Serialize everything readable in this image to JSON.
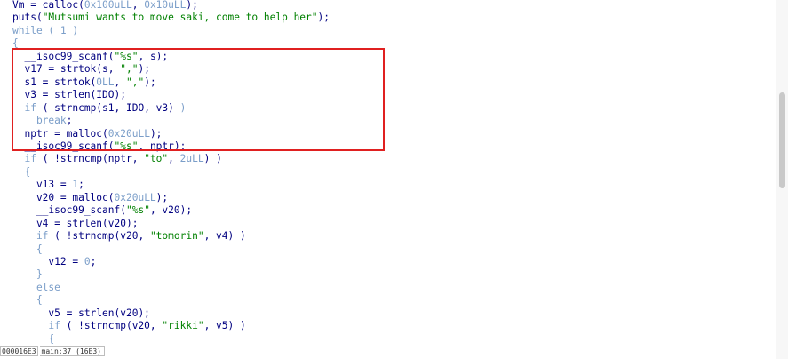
{
  "code_lines": [
    {
      "tokens": [
        {
          "t": "Vm = calloc(",
          "c": "plain"
        },
        {
          "t": "0x100uLL",
          "c": "num"
        },
        {
          "t": ", ",
          "c": "plain"
        },
        {
          "t": "0x10uLL",
          "c": "num"
        },
        {
          "t": ");",
          "c": "plain"
        }
      ]
    },
    {
      "tokens": [
        {
          "t": "puts(",
          "c": "plain"
        },
        {
          "t": "\"Mutsumi wants to move saki, come to help her\"",
          "c": "str"
        },
        {
          "t": ");",
          "c": "plain"
        }
      ]
    },
    {
      "tokens": [
        {
          "t": "while",
          "c": "kw"
        },
        {
          "t": " ( ",
          "c": "kw"
        },
        {
          "t": "1",
          "c": "num"
        },
        {
          "t": " )",
          "c": "kw"
        }
      ]
    },
    {
      "tokens": [
        {
          "t": "{",
          "c": "brace"
        }
      ]
    },
    {
      "tokens": [
        {
          "t": "  __isoc99_scanf(",
          "c": "plain"
        },
        {
          "t": "\"%s\"",
          "c": "str"
        },
        {
          "t": ", s);",
          "c": "plain"
        }
      ]
    },
    {
      "tokens": [
        {
          "t": "  v17 = strtok(s, ",
          "c": "plain"
        },
        {
          "t": "\",\"",
          "c": "str"
        },
        {
          "t": ");",
          "c": "plain"
        }
      ]
    },
    {
      "tokens": [
        {
          "t": "  s1 = strtok(",
          "c": "plain"
        },
        {
          "t": "0LL",
          "c": "num"
        },
        {
          "t": ", ",
          "c": "plain"
        },
        {
          "t": "\",\"",
          "c": "str"
        },
        {
          "t": ");",
          "c": "plain"
        }
      ]
    },
    {
      "tokens": [
        {
          "t": "  v3 = strlen(IDO);",
          "c": "plain"
        }
      ]
    },
    {
      "tokens": [
        {
          "t": "  if",
          "c": "kw"
        },
        {
          "t": " ( strncmp(s1, IDO, v3) ",
          "c": "plain"
        },
        {
          "t": ")",
          "c": "kw"
        }
      ]
    },
    {
      "tokens": [
        {
          "t": "    break",
          "c": "kw"
        },
        {
          "t": ";",
          "c": "plain"
        }
      ]
    },
    {
      "tokens": [
        {
          "t": "  nptr = malloc(",
          "c": "plain"
        },
        {
          "t": "0x20uLL",
          "c": "num"
        },
        {
          "t": ");",
          "c": "plain"
        }
      ]
    },
    {
      "tokens": [
        {
          "t": "  __isoc99_scanf(",
          "c": "plain"
        },
        {
          "t": "\"%s\"",
          "c": "str"
        },
        {
          "t": ", nptr);",
          "c": "plain"
        }
      ]
    },
    {
      "tokens": [
        {
          "t": "  if",
          "c": "kw"
        },
        {
          "t": " ( !strncmp(nptr, ",
          "c": "plain"
        },
        {
          "t": "\"to\"",
          "c": "str"
        },
        {
          "t": ", ",
          "c": "plain"
        },
        {
          "t": "2uLL",
          "c": "num"
        },
        {
          "t": ") )",
          "c": "plain"
        }
      ]
    },
    {
      "tokens": [
        {
          "t": "  {",
          "c": "brace"
        }
      ]
    },
    {
      "tokens": [
        {
          "t": "    v13 = ",
          "c": "plain"
        },
        {
          "t": "1",
          "c": "num"
        },
        {
          "t": ";",
          "c": "plain"
        }
      ]
    },
    {
      "tokens": [
        {
          "t": "    v20 = malloc(",
          "c": "plain"
        },
        {
          "t": "0x20uLL",
          "c": "num"
        },
        {
          "t": ");",
          "c": "plain"
        }
      ]
    },
    {
      "tokens": [
        {
          "t": "    __isoc99_scanf(",
          "c": "plain"
        },
        {
          "t": "\"%s\"",
          "c": "str"
        },
        {
          "t": ", v20);",
          "c": "plain"
        }
      ]
    },
    {
      "tokens": [
        {
          "t": "    v4 = strlen(v20);",
          "c": "plain"
        }
      ]
    },
    {
      "tokens": [
        {
          "t": "    if",
          "c": "kw"
        },
        {
          "t": " ( !strncmp(v20, ",
          "c": "plain"
        },
        {
          "t": "\"tomorin\"",
          "c": "str"
        },
        {
          "t": ", v4) )",
          "c": "plain"
        }
      ]
    },
    {
      "tokens": [
        {
          "t": "    {",
          "c": "brace"
        }
      ]
    },
    {
      "tokens": [
        {
          "t": "      v12 = ",
          "c": "plain"
        },
        {
          "t": "0",
          "c": "num"
        },
        {
          "t": ";",
          "c": "plain"
        }
      ]
    },
    {
      "tokens": [
        {
          "t": "    }",
          "c": "brace"
        }
      ]
    },
    {
      "tokens": [
        {
          "t": "    else",
          "c": "kw"
        }
      ]
    },
    {
      "tokens": [
        {
          "t": "    {",
          "c": "brace"
        }
      ]
    },
    {
      "tokens": [
        {
          "t": "      v5 = strlen(v20);",
          "c": "plain"
        }
      ]
    },
    {
      "tokens": [
        {
          "t": "      if",
          "c": "kw"
        },
        {
          "t": " ( !strncmp(v20, ",
          "c": "plain"
        },
        {
          "t": "\"rikki\"",
          "c": "str"
        },
        {
          "t": ", v5) )",
          "c": "plain"
        }
      ]
    },
    {
      "tokens": [
        {
          "t": "      {",
          "c": "brace"
        }
      ]
    }
  ],
  "status_bar": {
    "address": "000016E3",
    "location": "main:37 (16E3)"
  },
  "colors": {
    "plain": "#000080",
    "keyword": "#7b9ec9",
    "string": "#008000",
    "highlight_box": "#e02020"
  }
}
